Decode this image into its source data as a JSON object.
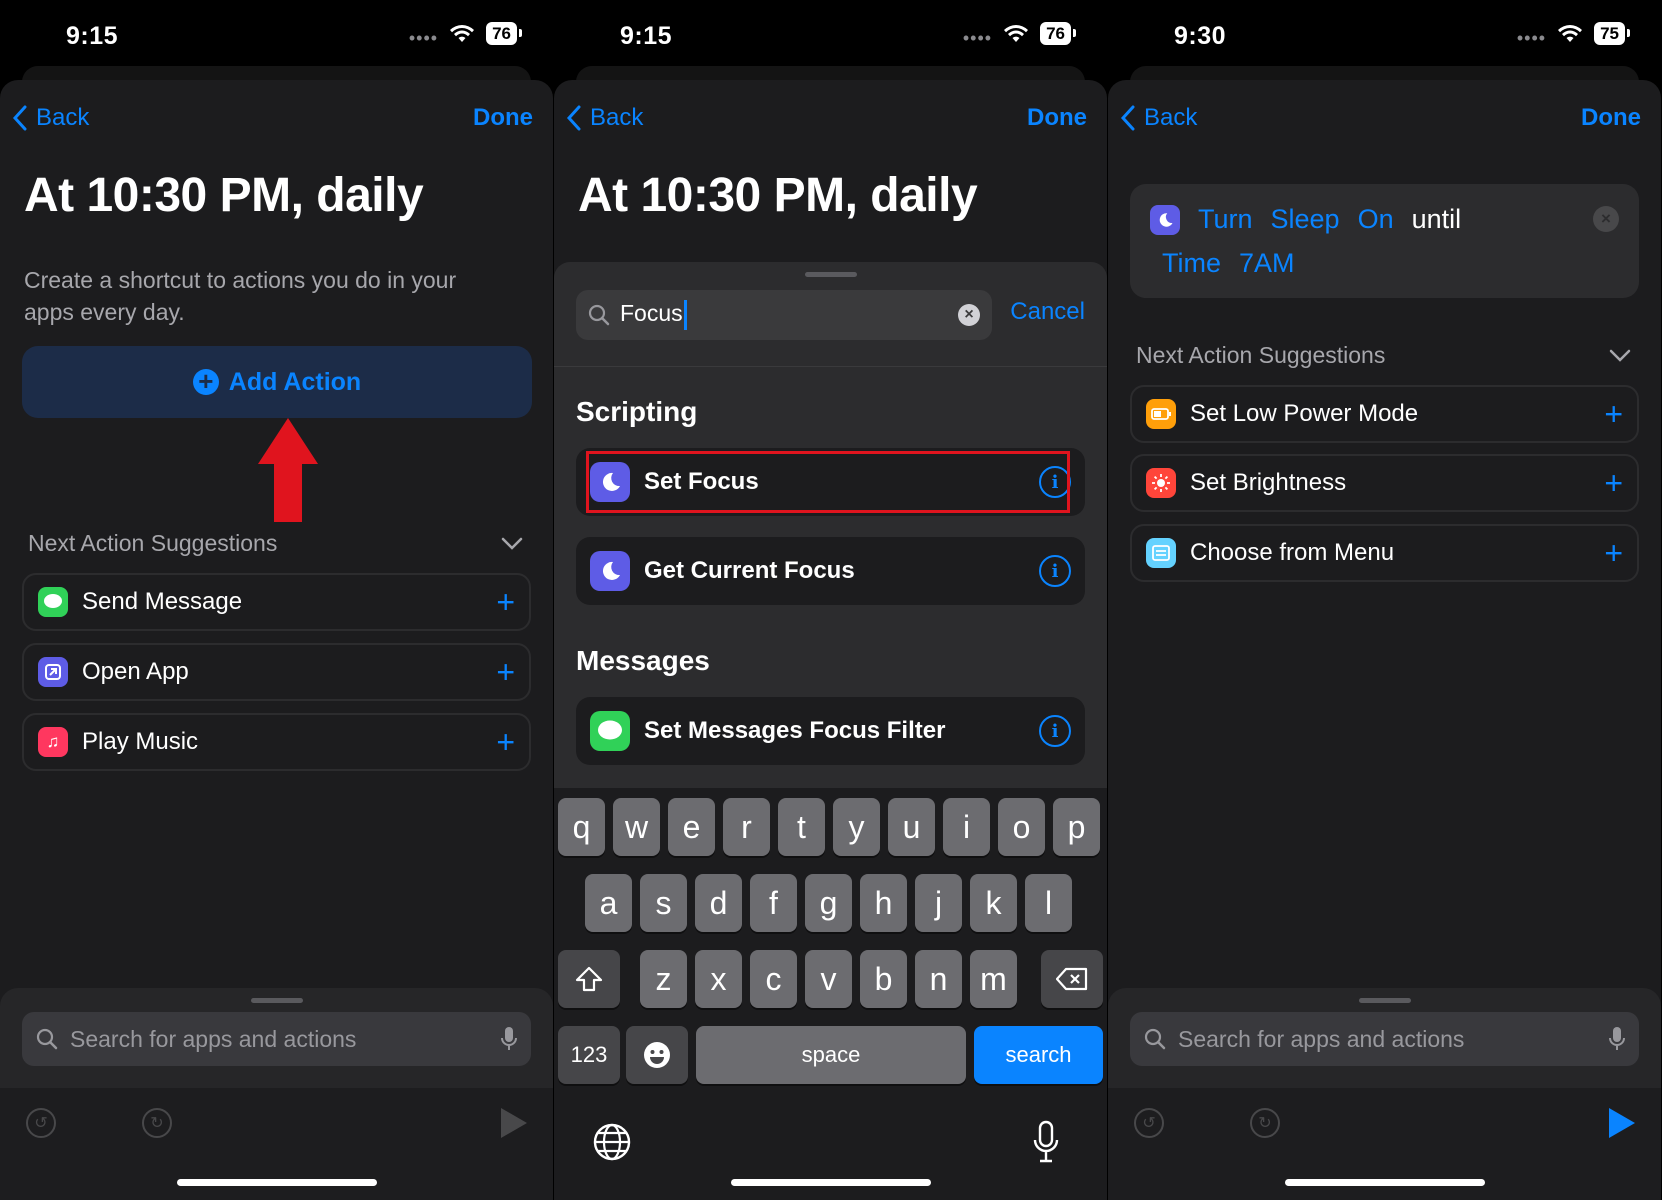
{
  "panel1": {
    "status": {
      "time": "9:15",
      "battery": "76"
    },
    "nav": {
      "back": "Back",
      "done": "Done"
    },
    "title": "At 10:30 PM, daily",
    "description": "Create a shortcut to actions you do in your apps every day.",
    "add_action": "Add Action",
    "suggestions_header": "Next Action Suggestions",
    "suggestions": [
      {
        "label": "Send Message",
        "icon": "messages-icon",
        "color": "#30d158"
      },
      {
        "label": "Open App",
        "icon": "open-app-icon",
        "color": "#5e5ce6"
      },
      {
        "label": "Play Music",
        "icon": "music-icon",
        "color": "#ff375f"
      }
    ],
    "search_placeholder": "Search for apps and actions"
  },
  "panel2": {
    "status": {
      "time": "9:15",
      "battery": "76"
    },
    "nav": {
      "back": "Back",
      "done": "Done"
    },
    "title": "At 10:30 PM, daily",
    "search_value": "Focus",
    "cancel": "Cancel",
    "sections": [
      {
        "title": "Scripting",
        "items": [
          {
            "label": "Set Focus",
            "icon": "moon-icon",
            "color": "#5e5ce6",
            "highlighted": true
          },
          {
            "label": "Get Current Focus",
            "icon": "moon-icon",
            "color": "#5e5ce6"
          }
        ]
      },
      {
        "title": "Messages",
        "items": [
          {
            "label": "Set Messages Focus Filter",
            "icon": "messages-icon",
            "color": "#30d158"
          }
        ]
      }
    ],
    "keyboard": {
      "row1": [
        "q",
        "w",
        "e",
        "r",
        "t",
        "y",
        "u",
        "i",
        "o",
        "p"
      ],
      "row2": [
        "a",
        "s",
        "d",
        "f",
        "g",
        "h",
        "j",
        "k",
        "l"
      ],
      "row3": [
        "z",
        "x",
        "c",
        "v",
        "b",
        "n",
        "m"
      ],
      "numbers": "123",
      "space": "space",
      "search": "search"
    }
  },
  "panel3": {
    "status": {
      "time": "9:30",
      "battery": "75"
    },
    "nav": {
      "back": "Back",
      "done": "Done"
    },
    "action": {
      "verb": "Turn",
      "focus": "Sleep",
      "state": "On",
      "until": "until",
      "mode": "Time",
      "time": "7AM"
    },
    "suggestions_header": "Next Action Suggestions",
    "suggestions": [
      {
        "label": "Set Low Power Mode",
        "icon": "battery-icon",
        "color": "#ff9f0a"
      },
      {
        "label": "Set Brightness",
        "icon": "brightness-icon",
        "color": "#ff453a"
      },
      {
        "label": "Choose from Menu",
        "icon": "menu-icon",
        "color": "#64d2ff"
      }
    ],
    "search_placeholder": "Search for apps and actions"
  },
  "colors": {
    "accent": "#0a84ff",
    "highlight": "#e0141e",
    "arrow": "#e0141e"
  }
}
